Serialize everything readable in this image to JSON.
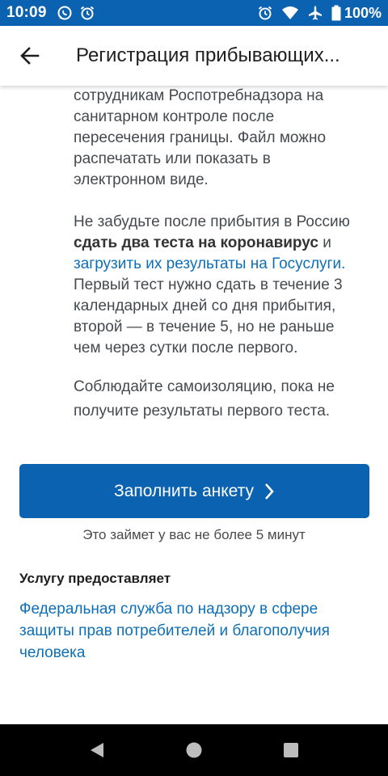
{
  "status_bar": {
    "time": "10:09",
    "battery": "100%",
    "background": "#0b62b1"
  },
  "app_bar": {
    "title": "Регистрация прибывающих..."
  },
  "content": {
    "p1_lines": [
      "сотрудникам Роспотребнадзора на",
      "санитарном контроле после",
      "пересечения границы. Файл можно",
      "распечатать или показать в",
      "электронном виде."
    ],
    "p2": {
      "line1": "Не забудьте после прибытия в Россию",
      "bold": "сдать два теста на коронавирус",
      "after_bold": " и",
      "link": "загрузить их результаты на Госуслуги.",
      "rest_lines": [
        "Первый тест нужно сдать в течение 3",
        "календарных дней со дня прибытия,",
        "второй — в течение 5, но не раньше",
        "чем через сутки после первого."
      ]
    },
    "p3_lines": [
      "Соблюдайте самоизоляцию, пока не",
      "получите результаты первого теста."
    ],
    "fill_button_label": "Заполнить анкету",
    "time_note": "Это займет у вас не более 5 минут",
    "provider_heading": "Услугу предоставляет",
    "provider_lines": [
      "Федеральная служба по надзору в сфере",
      "защиты прав потребителей и благополучия",
      "человека"
    ]
  },
  "colors": {
    "accent": "#0b62b1",
    "link": "#0d6fb8",
    "text": "#454a4f"
  }
}
